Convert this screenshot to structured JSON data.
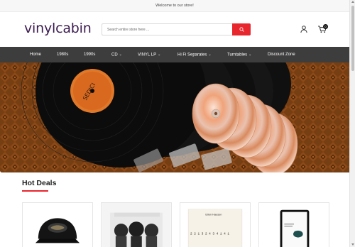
{
  "topbar": {
    "message": "Welcome to our store!"
  },
  "header": {
    "logo": "vinylcabin",
    "search_placeholder": "Search entire store here ...",
    "cart_count": "0"
  },
  "nav": {
    "items": [
      {
        "label": "Home",
        "dropdown": false
      },
      {
        "label": "1980s",
        "dropdown": false
      },
      {
        "label": "1990s",
        "dropdown": false
      },
      {
        "label": "CD",
        "dropdown": true
      },
      {
        "label": "VINYL LP",
        "dropdown": true
      },
      {
        "label": "Hi Fi Separates",
        "dropdown": true
      },
      {
        "label": "Turntables",
        "dropdown": true
      },
      {
        "label": "Discount Zone",
        "dropdown": false
      }
    ],
    "chevron": "⌄"
  },
  "hero": {
    "record_label_text": "SEDICI"
  },
  "section": {
    "title": "Hot Deals"
  },
  "products": {
    "book_title": "Ellen Hausen",
    "book_digits": "2 2 1 3 2 4 3 4 1 4 1"
  },
  "colors": {
    "accent": "#e8262d",
    "nav_bg": "#3d3d3d",
    "logo": "#3b1b4f"
  }
}
